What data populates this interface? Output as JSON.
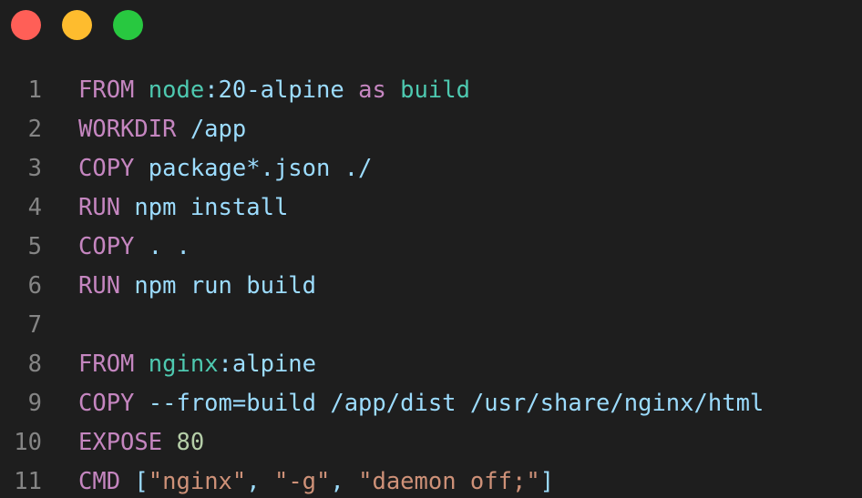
{
  "window": {
    "traffic_lights": {
      "close": "#ff5f57",
      "minimize": "#febc2e",
      "maximize": "#28c840"
    }
  },
  "editor": {
    "colors": {
      "background": "#1e1e1e",
      "line_number": "#858585",
      "keyword": "#c586c0",
      "type": "#4ec9b0",
      "text": "#9cdcfe",
      "number": "#b5cea8",
      "string": "#ce9178"
    },
    "lines": [
      {
        "number": "1",
        "tokens": [
          {
            "text": "FROM",
            "kind": "keyword"
          },
          {
            "text": " ",
            "kind": "text"
          },
          {
            "text": "node",
            "kind": "type"
          },
          {
            "text": ":20-alpine ",
            "kind": "text"
          },
          {
            "text": "as",
            "kind": "keyword"
          },
          {
            "text": " ",
            "kind": "text"
          },
          {
            "text": "build",
            "kind": "type"
          }
        ]
      },
      {
        "number": "2",
        "tokens": [
          {
            "text": "WORKDIR",
            "kind": "keyword"
          },
          {
            "text": " /app",
            "kind": "text"
          }
        ]
      },
      {
        "number": "3",
        "tokens": [
          {
            "text": "COPY",
            "kind": "keyword"
          },
          {
            "text": " package*.json ./",
            "kind": "text"
          }
        ]
      },
      {
        "number": "4",
        "tokens": [
          {
            "text": "RUN",
            "kind": "keyword"
          },
          {
            "text": " npm install",
            "kind": "text"
          }
        ]
      },
      {
        "number": "5",
        "tokens": [
          {
            "text": "COPY",
            "kind": "keyword"
          },
          {
            "text": " . .",
            "kind": "text"
          }
        ]
      },
      {
        "number": "6",
        "tokens": [
          {
            "text": "RUN",
            "kind": "keyword"
          },
          {
            "text": " npm run build",
            "kind": "text"
          }
        ]
      },
      {
        "number": "7",
        "tokens": []
      },
      {
        "number": "8",
        "tokens": [
          {
            "text": "FROM",
            "kind": "keyword"
          },
          {
            "text": " ",
            "kind": "text"
          },
          {
            "text": "nginx",
            "kind": "type"
          },
          {
            "text": ":alpine",
            "kind": "text"
          }
        ]
      },
      {
        "number": "9",
        "tokens": [
          {
            "text": "COPY",
            "kind": "keyword"
          },
          {
            "text": " --from=build /app/dist /usr/share/nginx/html",
            "kind": "text"
          }
        ]
      },
      {
        "number": "10",
        "tokens": [
          {
            "text": "EXPOSE",
            "kind": "keyword"
          },
          {
            "text": " ",
            "kind": "text"
          },
          {
            "text": "80",
            "kind": "number"
          }
        ]
      },
      {
        "number": "11",
        "tokens": [
          {
            "text": "CMD",
            "kind": "keyword"
          },
          {
            "text": " [",
            "kind": "text"
          },
          {
            "text": "\"nginx\"",
            "kind": "string"
          },
          {
            "text": ", ",
            "kind": "text"
          },
          {
            "text": "\"-g\"",
            "kind": "string"
          },
          {
            "text": ", ",
            "kind": "text"
          },
          {
            "text": "\"daemon off;\"",
            "kind": "string"
          },
          {
            "text": "]",
            "kind": "text"
          }
        ]
      }
    ]
  }
}
